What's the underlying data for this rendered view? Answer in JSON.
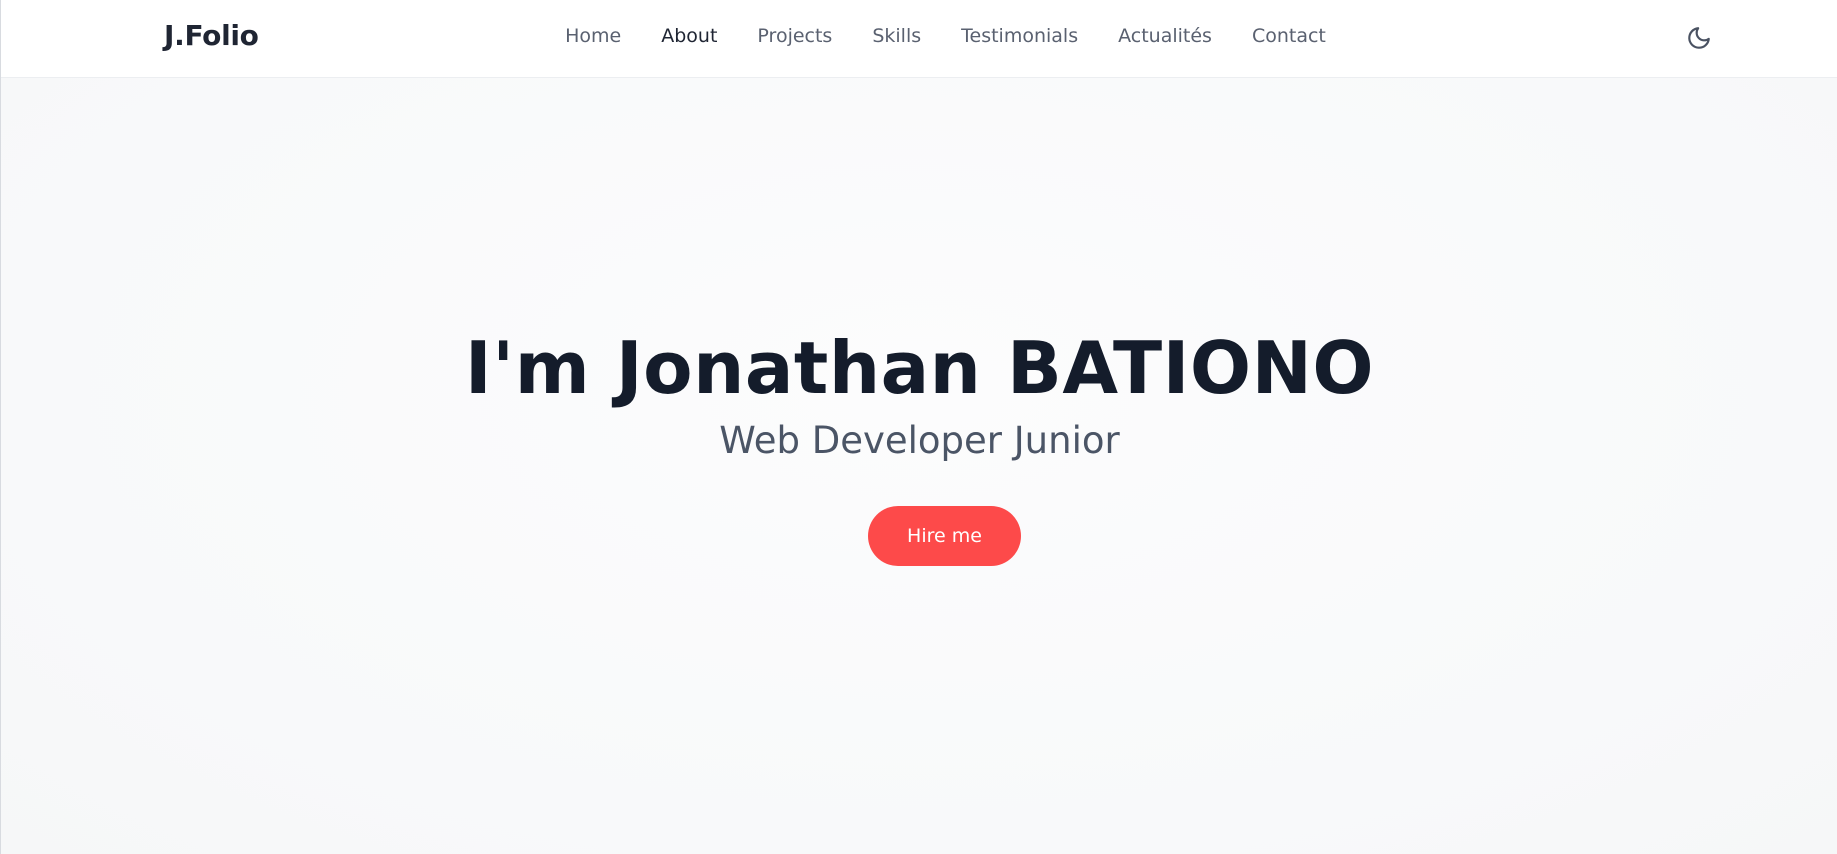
{
  "header": {
    "brand": "J.Folio",
    "nav": [
      {
        "label": "Home",
        "active": false
      },
      {
        "label": "About",
        "active": true
      },
      {
        "label": "Projects",
        "active": false
      },
      {
        "label": "Skills",
        "active": false
      },
      {
        "label": "Testimonials",
        "active": false
      },
      {
        "label": "Actualités",
        "active": false
      },
      {
        "label": "Contact",
        "active": false
      }
    ],
    "theme_toggle_icon": "moon-icon"
  },
  "hero": {
    "title": "I'm Jonathan BATIONO",
    "subtitle": "Web Developer Junior",
    "cta_label": "Hire me"
  },
  "colors": {
    "accent": "#fd4a4a",
    "heading": "#141c2b",
    "text_muted": "#5a6170"
  }
}
